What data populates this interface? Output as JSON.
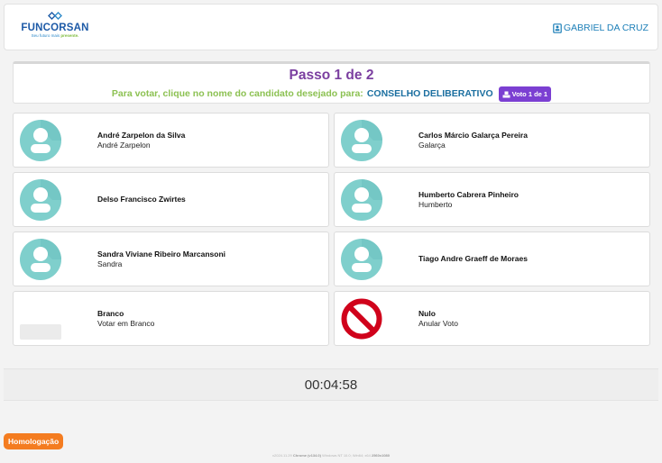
{
  "header": {
    "logo_name": "FUNCORSAN",
    "logo_tagline_prefix": "Seu futuro mais",
    "logo_tagline_emphasis": "presente.",
    "user_name": "GABRIEL DA CRUZ",
    "user_icon": "id-badge-icon"
  },
  "step": {
    "title": "Passo 1 de 2",
    "instruction": "Para votar, clique no nome do candidato desejado para:",
    "council": "CONSELHO DELIBERATIVO",
    "badge": "Voto 1 de 1",
    "badge_icon": "ballot-icon"
  },
  "candidates": [
    {
      "name": "André Zarpelon da Silva",
      "alias": "André Zarpelon"
    },
    {
      "name": "Carlos Márcio Galarça Pereira",
      "alias": "Galarça"
    },
    {
      "name": "Delso Francisco Zwirtes",
      "alias": ""
    },
    {
      "name": "Humberto Cabrera Pinheiro",
      "alias": "Humberto"
    },
    {
      "name": "Sandra Viviane Ribeiro Marcansoni",
      "alias": "Sandra"
    },
    {
      "name": "Tiago Andre Graeff de Moraes",
      "alias": ""
    }
  ],
  "blank": {
    "name": "Branco",
    "alias": "Votar em Branco"
  },
  "null_vote": {
    "name": "Nulo",
    "alias": "Anular Voto",
    "icon": "prohibited-icon"
  },
  "timer": "00:04:58",
  "environment_badge": "Homologação",
  "footer": {
    "version": "v2024.11.29",
    "browser": "Chrome (v134.0)",
    "os": "Windows NT 10.0; Win64; x64",
    "resolution": "2560x1080"
  },
  "colors": {
    "title": "#7b3fa0",
    "instruction": "#8cc152",
    "council": "#1b6fa0",
    "badge": "#7b3fd2",
    "avatar": "#7fcfcc",
    "null_icon": "#d0021b",
    "environment": "#f47c20",
    "user": "#1c7fb8"
  }
}
